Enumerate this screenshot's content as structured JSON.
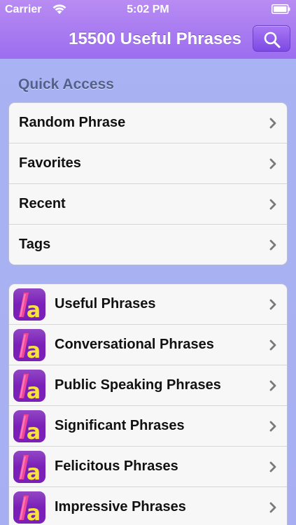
{
  "status": {
    "carrier": "Carrier",
    "time": "5:02 PM"
  },
  "nav": {
    "title": "15500 Useful Phrases",
    "search_icon": "search-icon"
  },
  "quick_access": {
    "header": "Quick Access",
    "items": [
      {
        "label": "Random Phrase"
      },
      {
        "label": "Favorites"
      },
      {
        "label": "Recent"
      },
      {
        "label": "Tags"
      }
    ]
  },
  "phrase_books": {
    "icon": "app-letter-a-icon",
    "items": [
      {
        "label": "Useful Phrases"
      },
      {
        "label": "Conversational Phrases"
      },
      {
        "label": "Public Speaking Phrases"
      },
      {
        "label": "Significant Phrases"
      },
      {
        "label": "Felicitous Phrases"
      },
      {
        "label": "Impressive Phrases"
      }
    ]
  },
  "colors": {
    "nav_bar": "#9c6df0",
    "background": "#a9b3f3",
    "section_header": "#53608c",
    "icon_bg": "#7a1fb8",
    "icon_pink": "#f0479a",
    "icon_yellow": "#f6e43a"
  }
}
